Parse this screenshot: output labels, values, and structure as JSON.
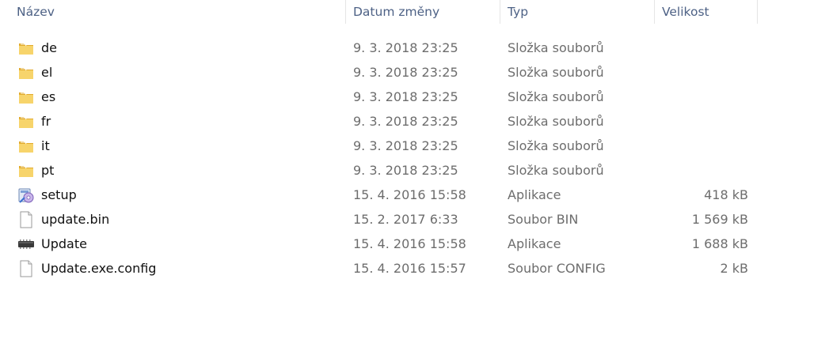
{
  "columns": {
    "name": "Název",
    "date": "Datum změny",
    "type": "Typ",
    "size": "Velikost"
  },
  "files": [
    {
      "name": "de",
      "date": "9. 3. 2018 23:25",
      "type": "Složka souborů",
      "size": "",
      "icon": "folder-icon"
    },
    {
      "name": "el",
      "date": "9. 3. 2018 23:25",
      "type": "Složka souborů",
      "size": "",
      "icon": "folder-icon"
    },
    {
      "name": "es",
      "date": "9. 3. 2018 23:25",
      "type": "Složka souborů",
      "size": "",
      "icon": "folder-icon"
    },
    {
      "name": "fr",
      "date": "9. 3. 2018 23:25",
      "type": "Složka souborů",
      "size": "",
      "icon": "folder-icon"
    },
    {
      "name": "it",
      "date": "9. 3. 2018 23:25",
      "type": "Složka souborů",
      "size": "",
      "icon": "folder-icon"
    },
    {
      "name": "pt",
      "date": "9. 3. 2018 23:25",
      "type": "Složka souborů",
      "size": "",
      "icon": "folder-icon"
    },
    {
      "name": "setup",
      "date": "15. 4. 2016 15:58",
      "type": "Aplikace",
      "size": "418 kB",
      "icon": "setup-icon"
    },
    {
      "name": "update.bin",
      "date": "15. 2. 2017 6:33",
      "type": "Soubor BIN",
      "size": "1 569 kB",
      "icon": "file-icon"
    },
    {
      "name": "Update",
      "date": "15. 4. 2016 15:58",
      "type": "Aplikace",
      "size": "1 688 kB",
      "icon": "chip-icon"
    },
    {
      "name": "Update.exe.config",
      "date": "15. 4. 2016 15:57",
      "type": "Soubor CONFIG",
      "size": "2 kB",
      "icon": "file-icon"
    }
  ],
  "colors": {
    "header_text": "#4d6185",
    "name_text": "#111111",
    "meta_text": "#6d6d6d",
    "folder": "#f4c64f"
  }
}
